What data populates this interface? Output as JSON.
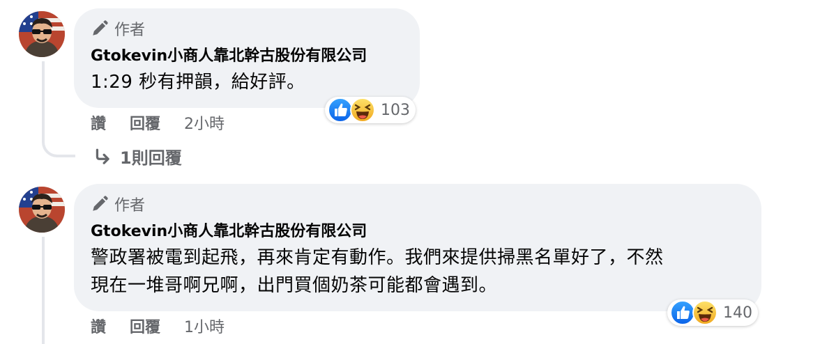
{
  "comments": [
    {
      "badge": "作者",
      "author": "Gtokevin小商人靠北幹古股份有限公司",
      "text_lines": [
        "1:29 秒有押韻，給好評。"
      ],
      "reaction_count": "103",
      "like_label": "讚",
      "reply_label": "回覆",
      "time": "2小時",
      "view_replies": "1則回覆"
    },
    {
      "badge": "作者",
      "author": "Gtokevin小商人靠北幹古股份有限公司",
      "text_lines": [
        "警政署被電到起飛，再來肯定有動作。我們來提供掃黑名單好了，不然",
        "現在一堆哥啊兄啊，出門買個奶茶可能都會遇到。"
      ],
      "reaction_count": "140",
      "like_label": "讚",
      "reply_label": "回覆",
      "time": "1小時"
    }
  ],
  "icons": {
    "badge": "pencil-icon",
    "reply_arrow": "reply-arrow-icon",
    "reactions": [
      "like-reaction-icon",
      "haha-reaction-icon"
    ]
  },
  "colors": {
    "bubble": "#f0f2f5",
    "muted_text": "#65676b",
    "like_blue": "#1877f2",
    "haha_yellow": "#f7c82d"
  }
}
